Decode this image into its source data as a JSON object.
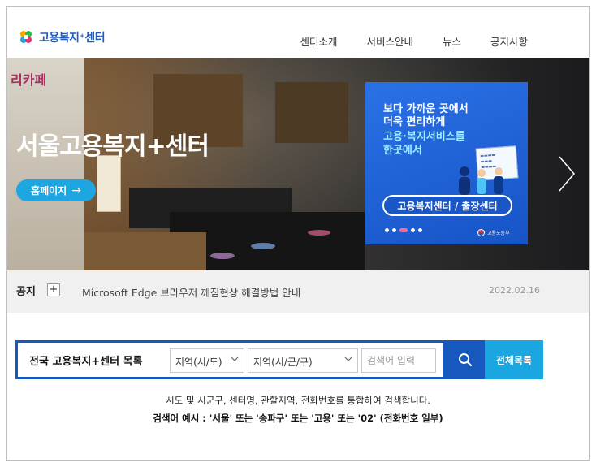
{
  "header": {
    "logo_text": "고용복지⁺센터",
    "nav": [
      "센터소개",
      "서비스안내",
      "뉴스",
      "공지사항"
    ]
  },
  "hero": {
    "wall_text": "리카페",
    "title": "서울고용복지+센터",
    "home_button": "홈페이지",
    "promo": {
      "line1": "보다 가까운 곳에서",
      "line2": "더욱 편리하게",
      "line3": "고용·복지서비스를",
      "line4": "한곳에서",
      "button": "고용복지센터 / 출장센터",
      "footer": "고용노동부"
    }
  },
  "notice": {
    "label": "공지",
    "text": "Microsoft Edge 브라우저 깨짐현상 해결방법 안내",
    "date": "2022.02.16"
  },
  "search": {
    "title": "전국 고용복지+센터 목록",
    "region_select": "지역(시/도)",
    "district_select": "지역(시/군/구)",
    "keyword_placeholder": "검색어 입력",
    "all_list_button": "전체목록",
    "help_line1": "시도 및 시군구, 센터명, 관할지역, 전화번호를 통합하여 검색합니다.",
    "help_line2": "검색어 예시 : '서울' 또는 '송파구' 또는 '고용' 또는 '02' (전화번호 일부)"
  },
  "colors": {
    "brand_blue": "#1758bf",
    "accent_cyan": "#1aa6e0"
  }
}
